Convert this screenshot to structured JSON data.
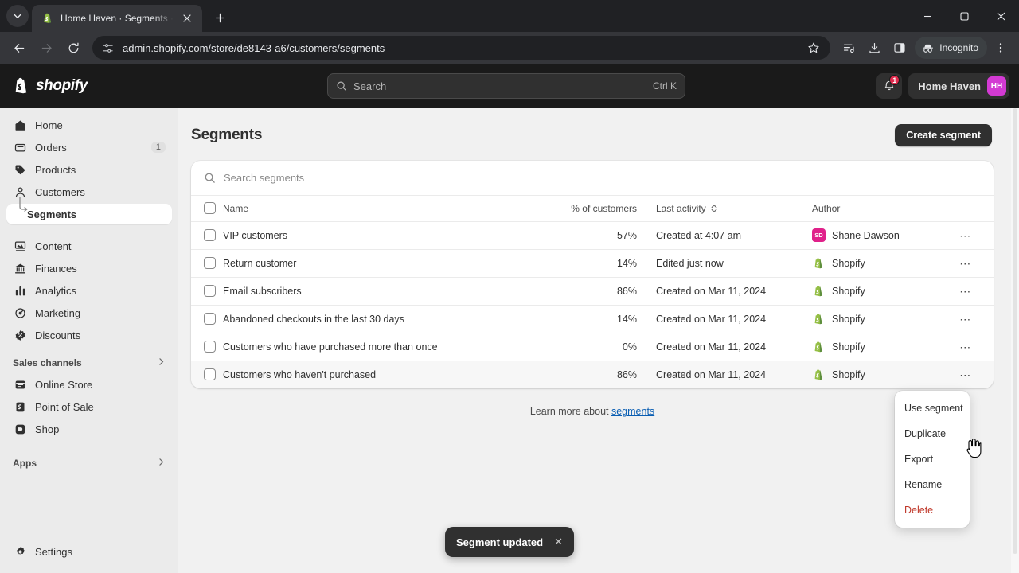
{
  "browser": {
    "tab": {
      "title": "Home Haven · Segments · Shop",
      "favicon": "shopify-bag-icon",
      "close_icon": "close-icon"
    },
    "new_tab_icon": "plus-icon",
    "tab_list_icon": "chevron-down-icon",
    "nav": {
      "back_icon": "back-arrow-icon",
      "forward_icon": "forward-arrow-icon",
      "reload_icon": "reload-icon"
    },
    "omnibox": {
      "site_settings_icon": "tune-icon",
      "url": "admin.shopify.com/store/de8143-a6/customers/segments"
    },
    "toolbar_icons": [
      "bookmark-star-icon",
      "reading-list-icon",
      "download-icon",
      "side-panel-icon",
      "menu-kebab-icon"
    ],
    "incognito": {
      "label": "Incognito",
      "icon": "incognito-hat-icon"
    },
    "window_controls": [
      "minimize-icon",
      "maximize-icon",
      "close-icon"
    ]
  },
  "topbar": {
    "logo_text": "shopify",
    "logo_icon": "shopify-bag-icon",
    "search": {
      "placeholder": "Search",
      "shortcut": "Ctrl K",
      "icon": "search-icon"
    },
    "notifications": {
      "icon": "bell-icon",
      "badge": "1"
    },
    "account": {
      "name": "Home Haven",
      "initials": "HH",
      "avatar_color": "#d33ad3"
    }
  },
  "sidebar": {
    "items": [
      {
        "label": "Home",
        "icon": "home-icon"
      },
      {
        "label": "Orders",
        "icon": "orders-bag-icon",
        "count": "1"
      },
      {
        "label": "Products",
        "icon": "products-tag-icon"
      },
      {
        "label": "Customers",
        "icon": "customers-person-icon"
      },
      {
        "label": "Segments",
        "icon": "subtree-arrow-icon",
        "active": true,
        "sub": true
      },
      {
        "label": "Content",
        "icon": "content-icon"
      },
      {
        "label": "Finances",
        "icon": "finances-bank-icon"
      },
      {
        "label": "Analytics",
        "icon": "analytics-bars-icon"
      },
      {
        "label": "Marketing",
        "icon": "marketing-target-icon"
      },
      {
        "label": "Discounts",
        "icon": "discounts-badge-icon"
      }
    ],
    "sections": [
      {
        "label": "Sales channels",
        "chevron": "chevron-right-icon",
        "items": [
          {
            "label": "Online Store",
            "icon": "online-store-icon"
          },
          {
            "label": "Point of Sale",
            "icon": "point-of-sale-icon"
          },
          {
            "label": "Shop",
            "icon": "shop-icon"
          }
        ]
      },
      {
        "label": "Apps",
        "chevron": "chevron-right-icon",
        "items": []
      }
    ],
    "settings": {
      "label": "Settings",
      "icon": "gear-icon"
    }
  },
  "main": {
    "title": "Segments",
    "create_button": "Create segment",
    "search": {
      "placeholder": "Search segments",
      "icon": "search-icon"
    },
    "table": {
      "headers": {
        "select_all": "select-all-checkbox",
        "name": "Name",
        "percent": "% of customers",
        "last_activity": "Last activity",
        "sort_icon": "sort-chevrons-icon",
        "author": "Author"
      },
      "rows": [
        {
          "name": "VIP customers",
          "percent": "57%",
          "activity": "Created at 4:07 am",
          "author": "Shane Dawson",
          "author_initials": "SD",
          "author_color": "#e0218a",
          "author_type": "user"
        },
        {
          "name": "Return customer",
          "percent": "14%",
          "activity": "Edited just now",
          "author": "Shopify",
          "author_type": "shopify"
        },
        {
          "name": "Email subscribers",
          "percent": "86%",
          "activity": "Created on Mar 11, 2024",
          "author": "Shopify",
          "author_type": "shopify"
        },
        {
          "name": "Abandoned checkouts in the last 30 days",
          "percent": "14%",
          "activity": "Created on Mar 11, 2024",
          "author": "Shopify",
          "author_type": "shopify"
        },
        {
          "name": "Customers who have purchased more than once",
          "percent": "0%",
          "activity": "Created on Mar 11, 2024",
          "author": "Shopify",
          "author_type": "shopify"
        },
        {
          "name": "Customers who haven't purchased",
          "percent": "86%",
          "activity": "Created on Mar 11, 2024",
          "author": "Shopify",
          "author_type": "shopify",
          "hovered": true
        }
      ]
    },
    "learn_more": {
      "prefix": "Learn more about ",
      "link": "segments"
    }
  },
  "popover": {
    "items": [
      {
        "label": "Use segment"
      },
      {
        "label": "Duplicate"
      },
      {
        "label": "Export"
      },
      {
        "label": "Rename"
      },
      {
        "label": "Delete",
        "danger": true
      }
    ]
  },
  "toast": {
    "message": "Segment updated",
    "close_icon": "close-icon",
    "close_label": "✕"
  }
}
